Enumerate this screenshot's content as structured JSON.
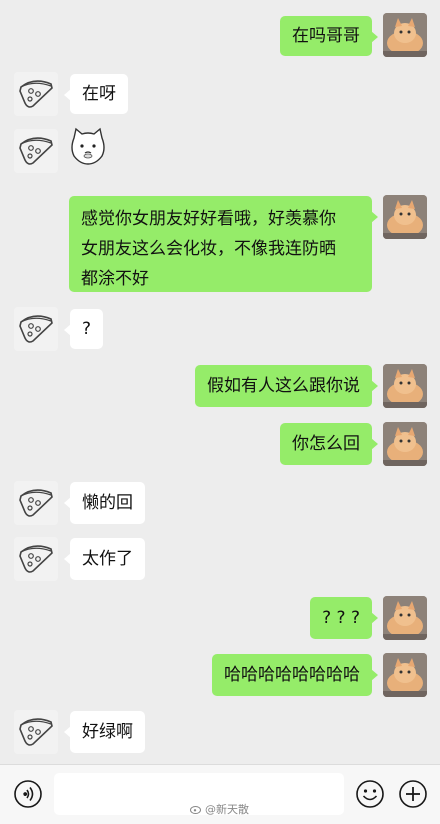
{
  "messages": [
    {
      "side": "me",
      "text": "在吗哥哥"
    },
    {
      "side": "them",
      "text": "在呀"
    },
    {
      "side": "them",
      "type": "sticker",
      "sticker": "cat-face-sticker"
    },
    {
      "side": "me",
      "text": "感觉你女朋友好好看哦，好羡慕你女朋友这么会化妆，不像我连防晒都涂不好",
      "lines": [
        "感觉你女朋友好好看哦，好羡慕你",
        "女朋友这么会化妆，不像我连防晒",
        "都涂不好"
      ]
    },
    {
      "side": "them",
      "text": "?"
    },
    {
      "side": "me",
      "text": "假如有人这么跟你说"
    },
    {
      "side": "me",
      "text": "你怎么回"
    },
    {
      "side": "them",
      "text": "懒的回"
    },
    {
      "side": "them",
      "text": "太作了"
    },
    {
      "side": "me",
      "text": "? ? ?"
    },
    {
      "side": "me",
      "text": "哈哈哈哈哈哈哈哈"
    },
    {
      "side": "them",
      "text": "好绿啊"
    }
  ],
  "input_bar": {
    "voice_icon": "voice-icon",
    "emoji_icon": "emoji-icon",
    "plus_icon": "plus-icon",
    "text_value": ""
  },
  "watermark": {
    "text": "@新天散"
  },
  "colors": {
    "background": "#ededed",
    "my_bubble": "#95ec69",
    "their_bubble": "#ffffff"
  }
}
